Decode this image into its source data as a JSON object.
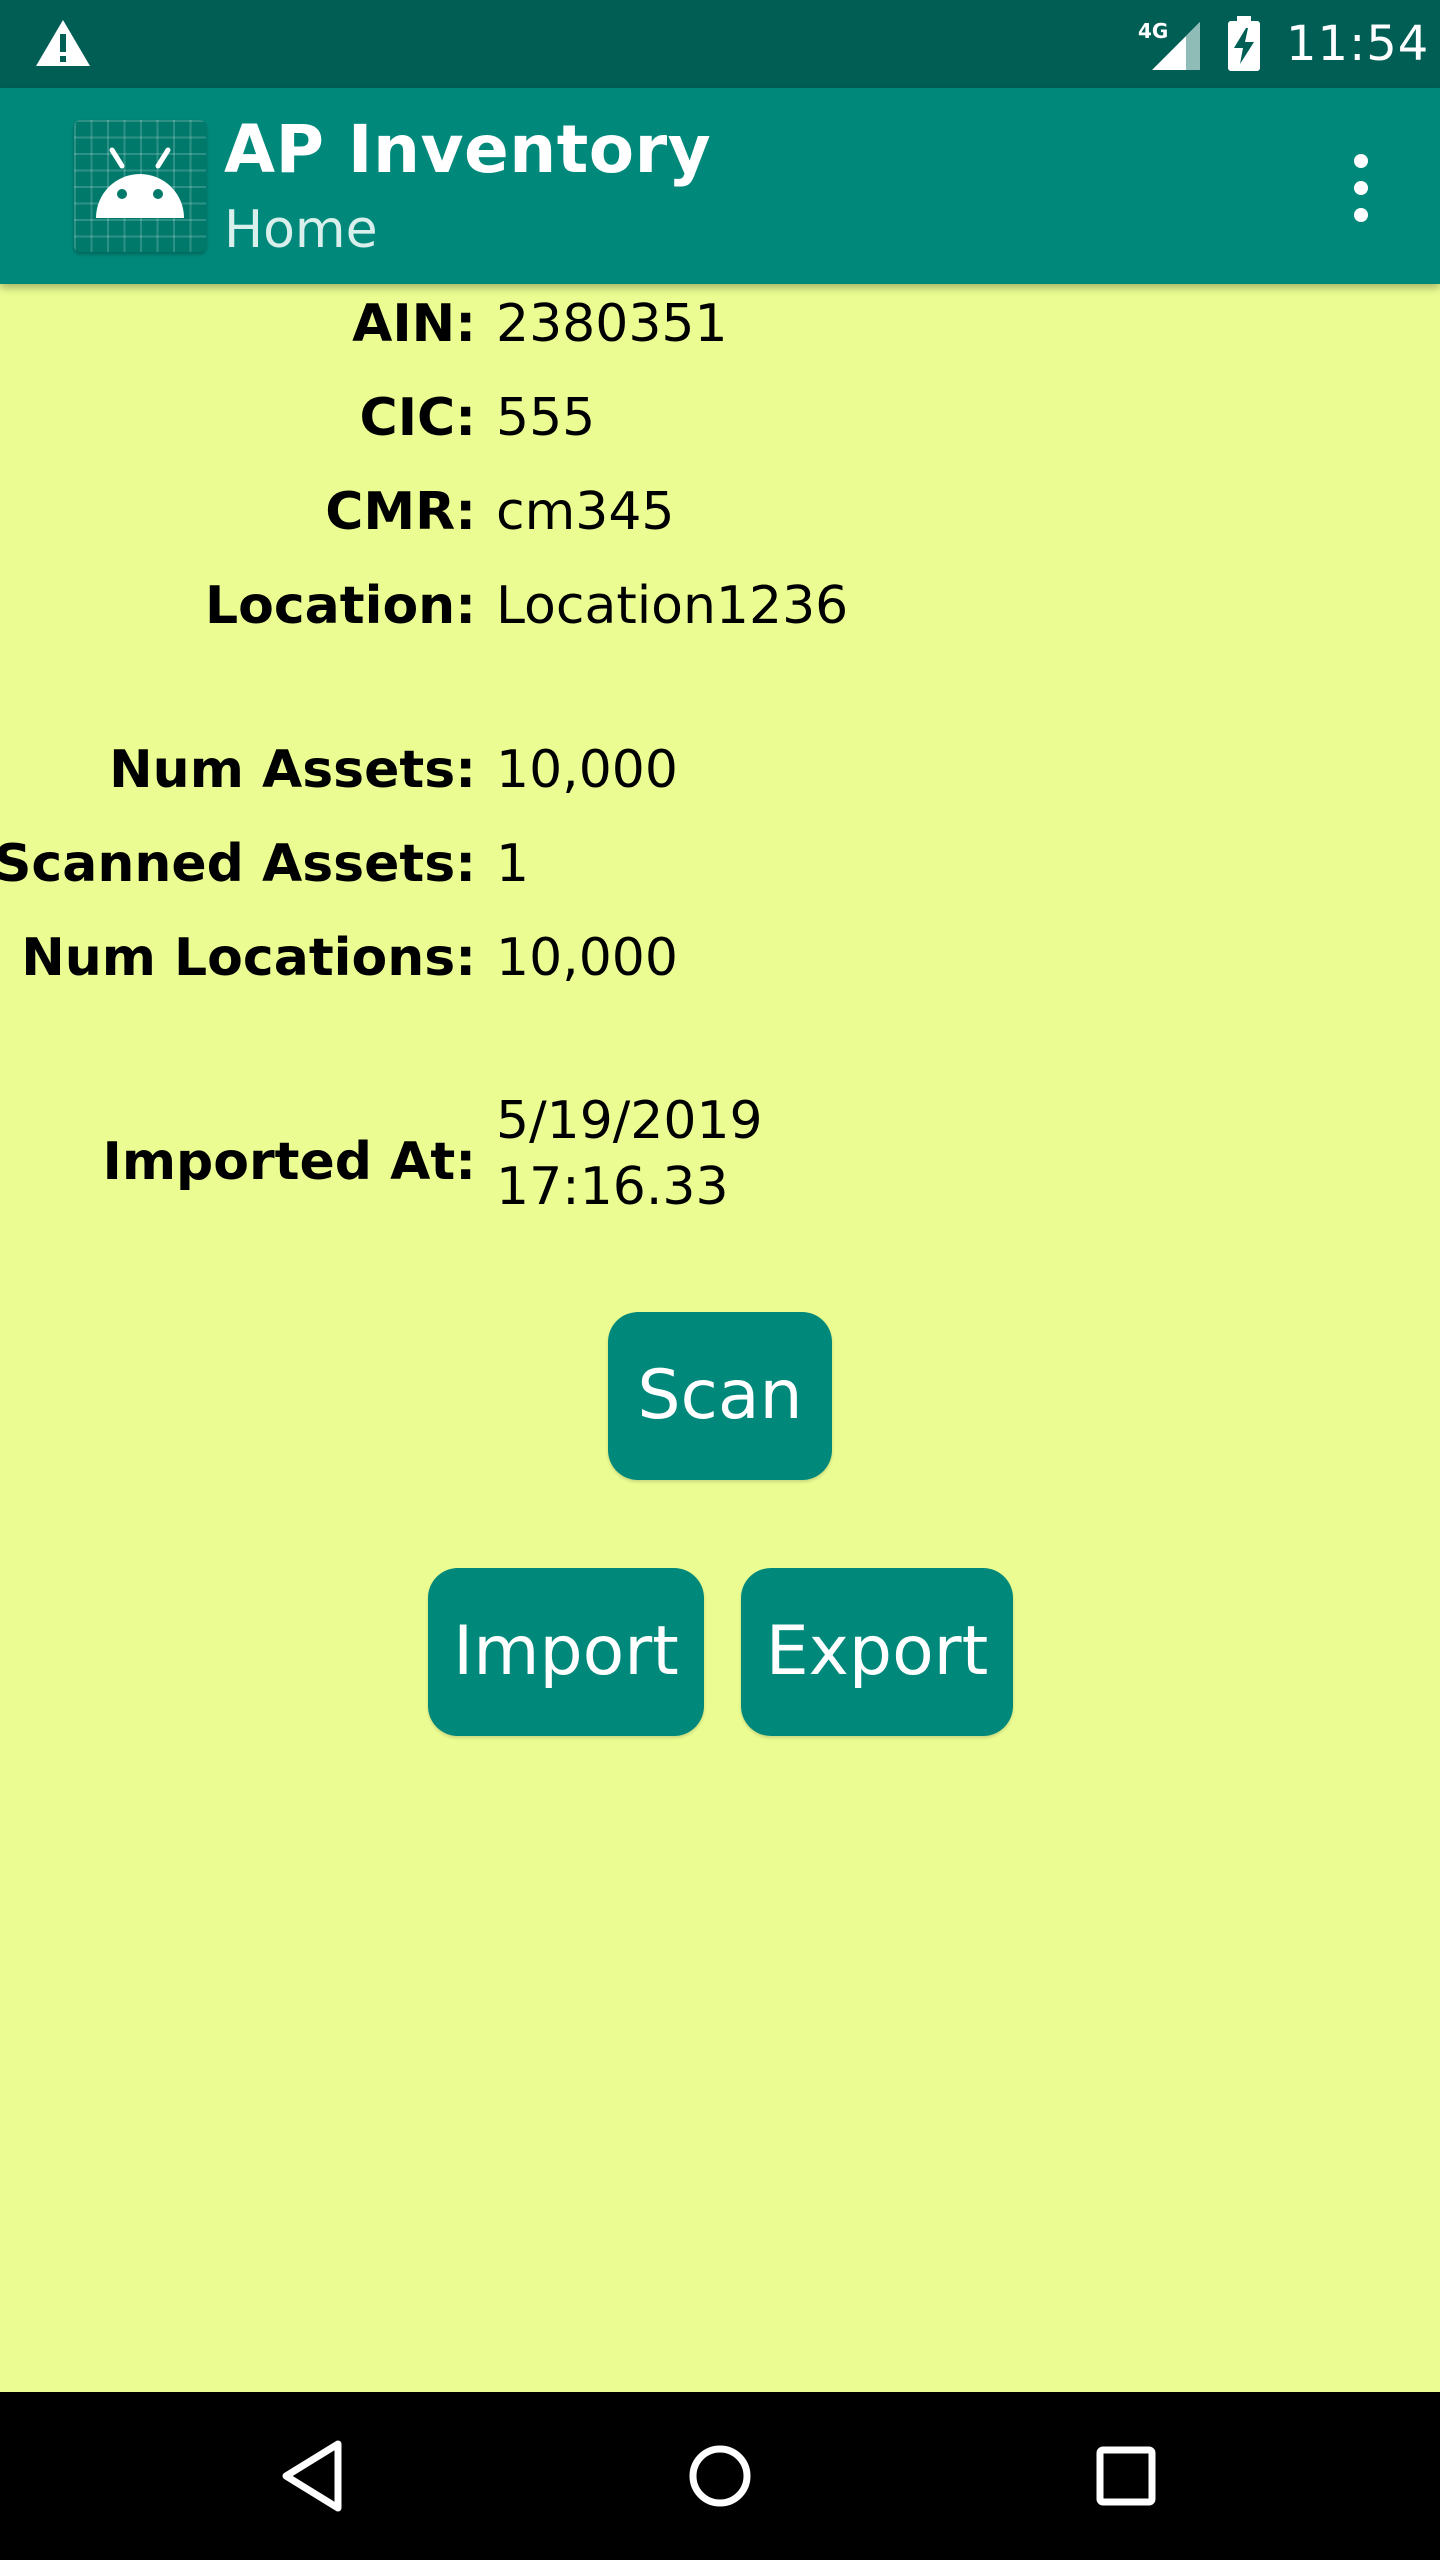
{
  "status_bar": {
    "network": "4G",
    "time": "11:54",
    "icons": [
      "warning-icon",
      "signal-icon",
      "battery-charging-icon"
    ]
  },
  "app_bar": {
    "title": "AP Inventory",
    "subtitle": "Home",
    "icons": [
      "android-app-icon",
      "more-vert-icon"
    ]
  },
  "info": {
    "ain": {
      "label": "AIN:",
      "value": "2380351"
    },
    "cic": {
      "label": "CIC:",
      "value": "555"
    },
    "cmr": {
      "label": "CMR:",
      "value": "cm345"
    },
    "location": {
      "label": "Location:",
      "value": "Location1236"
    },
    "num_assets": {
      "label": "Num Assets:",
      "value": "10,000"
    },
    "scanned_assets": {
      "label": "Scanned Assets:",
      "value": "1"
    },
    "num_locations": {
      "label": "Num Locations:",
      "value": "10,000"
    },
    "imported_at": {
      "label": "Imported At:",
      "value_date": "5/19/2019",
      "value_time": "17:16.33"
    }
  },
  "buttons": {
    "scan": "Scan",
    "import": "Import",
    "export": "Export"
  },
  "colors": {
    "status_bar": "#005e55",
    "app_bar": "#00897b",
    "background": "#ebfd92",
    "button": "#00897b",
    "nav_bar": "#000000"
  },
  "nav_bar": {
    "icons": [
      "back-icon",
      "home-icon",
      "recents-icon"
    ]
  }
}
